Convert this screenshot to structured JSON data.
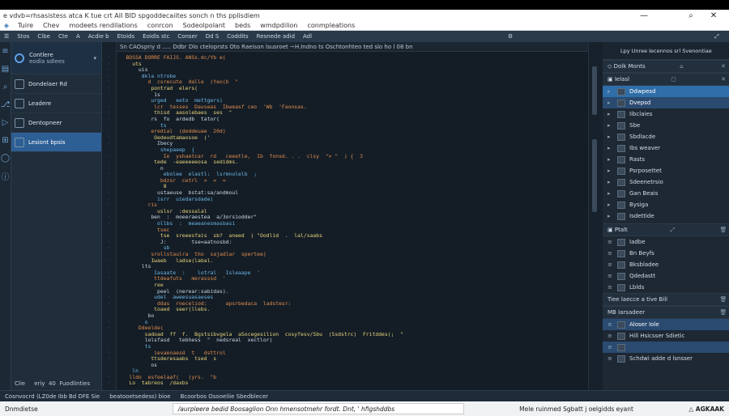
{
  "window": {
    "title": "e vdvb=rhsasistess atca K tue crt AII BID spgoddecaiites sonch n ths pplisdiem",
    "controls": [
      "—",
      "⌕",
      "✕"
    ]
  },
  "menubar": {
    "items": [
      "Tuire",
      "Chev",
      "modeets rendilations",
      "conrcon",
      "Sodeolpolant",
      "beds",
      "wmdpdilion",
      "conmpleations"
    ]
  },
  "toolbar": {
    "items": [
      "Stos",
      "Clbe",
      "Cte",
      "A",
      "Acdie b",
      "Etoids",
      "Eoidis stc",
      "Conser",
      "Dd S",
      "Coddits",
      "Resnede adid",
      "Adl"
    ]
  },
  "sidebar": {
    "header": {
      "title": "Contlere",
      "subtitle": "eodia sdlees"
    },
    "items": [
      {
        "label": "Dondelaer Rd",
        "active": false
      },
      {
        "label": "Leadere",
        "active": false
      },
      {
        "label": "Dentopneer",
        "active": false
      },
      {
        "label": "Lesiont bpsis",
        "active": true
      }
    ],
    "footer": [
      "Clie",
      "eriy",
      "40",
      "Fuodlinties"
    ]
  },
  "editor": {
    "tabline": "Sn  CAOspriy d ..... Ddbr Dlo cteloprsts  Oto Raeison lsusroet ~H.Indno   ts Oschtonhteo ted slo ho  l 08 bn",
    "lines": [
      "   BDSSA DORRE FAIJS. ANSs.dc/Yb e(",
      "     uts",
      "       uis",
      "        dkla ntrobe",
      "          d  csrecute  dalle  (Yeo(b  \"",
      "           pontrad  elers(",
      "            1s",
      "           urged   eeto  mettgers)",
      "            lcr  tesses  Dauseas  Ibweasf ceo  'Wb  'Faonxas.",
      "            thisd  aasolebaes  ses  \"",
      "           rs  fo  ardedb  tator(",
      "              ts",
      "           eredial  (deddeuae  20d)",
      "            Oedeudtamaosoe  ('",
      "             Ibecy",
      "              shepaeep  {",
      "               Ie  yshaetcar  rd   ceeetle,  Ib  fonsd. . .  clsy  \"> \"  ) {  3",
      "            tede  -eaeeeeeosa  sedidms.",
      "              n",
      "               ebolee  elastl:  lsrmnulelb  ;",
      "              bdzsr  cetrl  >  =  =",
      "               8",
      "             ustaeuse  bstat:sa/andmoul",
      "             isrr  uiedarsdade)",
      "          ris",
      "             uslsr  :dessalal",
      "           ben  :  moeeraestea  a/3orsiodder\"",
      "             ollbs  :  meaeanesmasbasi",
      "             tsec",
      "              tse  sreeesfais  sb?  aneed  ( \"Oodlid  .  lal/saabs",
      "              J:        tse=aatnosbd:",
      "               sb",
      "           srollstaulra  tho  sajadlar  spertee)",
      "           Iwaeb   ladse(labal.",
      "        lts",
      "            Iasaate  :    lotral   Isleaape  '",
      "            ttdeafuts   merasssd  '",
      "            ree",
      "             peel  (nerear:sabidas).",
      "            udel  aweesuasaeses",
      "             ddas  rneceliod:      apsrbedaca  ladstesr:",
      "            toaed  seer(llebs.",
      "          bo",
      "         o",
      "       Ddeelde(",
      "         sadoad  ff  f.  Bgstsibvgela  aSocegesilion  cosyfesv/Sbu  (Ssdstrc)  Fritddes(;  \"",
      "         lolsfasd   tebhess  \"  nedsreal  xectlor(",
      "         ts",
      "            ievaenaesd  t   dsttrol",
      "           ttsderesaabs  tsed  s",
      "           os",
      "     ln",
      "    lldo  esfeelaaf(   (yrs.  \"b",
      "    Lo  tabreos  /daxbs"
    ]
  },
  "right_panel": {
    "header_title": "Lpy Unree Iecennos srl Svenontiae",
    "sub_title": "Dolk Monts",
    "section_title": "Ielasl",
    "tree": [
      {
        "label": "Ddwpesd",
        "state": "sel"
      },
      {
        "label": "Dvepsd",
        "state": "sel2"
      },
      {
        "label": "Iibclaies",
        "state": ""
      },
      {
        "label": "Sbe",
        "state": ""
      },
      {
        "label": "Sbdlacde",
        "state": ""
      },
      {
        "label": "Ibs weaver",
        "state": ""
      },
      {
        "label": "Rasts",
        "state": ""
      },
      {
        "label": "Psrposettet",
        "state": ""
      },
      {
        "label": "Sdeenetrsio",
        "state": ""
      },
      {
        "label": "Gan Beais",
        "state": ""
      },
      {
        "label": "Bysiga",
        "state": ""
      },
      {
        "label": "Isdettide",
        "state": ""
      }
    ],
    "section2_title": "Ptalt",
    "tree2": [
      {
        "label": "Iadbe"
      },
      {
        "label": "Bn Beyfs"
      },
      {
        "label": "Bksbladee"
      },
      {
        "label": "Qdedastt"
      },
      {
        "label": "Lblds"
      }
    ],
    "section3_label": "Tiee  laecce a tive Bili",
    "section4_title": "MB  Iarsadeer",
    "tree3": [
      {
        "label": "Aloser Iole",
        "state": "sel2"
      },
      {
        "label": "Hill Hsicsser  Sdietic",
        "state": ""
      },
      {
        "label": "",
        "state": "sel2"
      },
      {
        "label": "Schdwi  adde d  lsnsser",
        "state": ""
      }
    ]
  },
  "statusbar": {
    "items": [
      "Cosnvocrd  (LZ0de  Ibb  Bd  DFE  Sie",
      "beatooetsedess)  bioe",
      "Bcoorbos  Osooeliie  Sbedblecer"
    ]
  },
  "bottombar": {
    "left": "Dnmdietse",
    "center": "/aurpleere bedid Boosaglion Onn hmensotmehr fordt.  Dnt, ' hfigshddbs",
    "right_text": "Mele  ruinmed Sgbatt j oelgidds eyant",
    "right_badge": "AGKAAK"
  },
  "colors": {
    "accent": "#2f6ea8",
    "editor_bg": "#141d26",
    "keyword": "#e08c4c",
    "string": "#e7d27a"
  }
}
